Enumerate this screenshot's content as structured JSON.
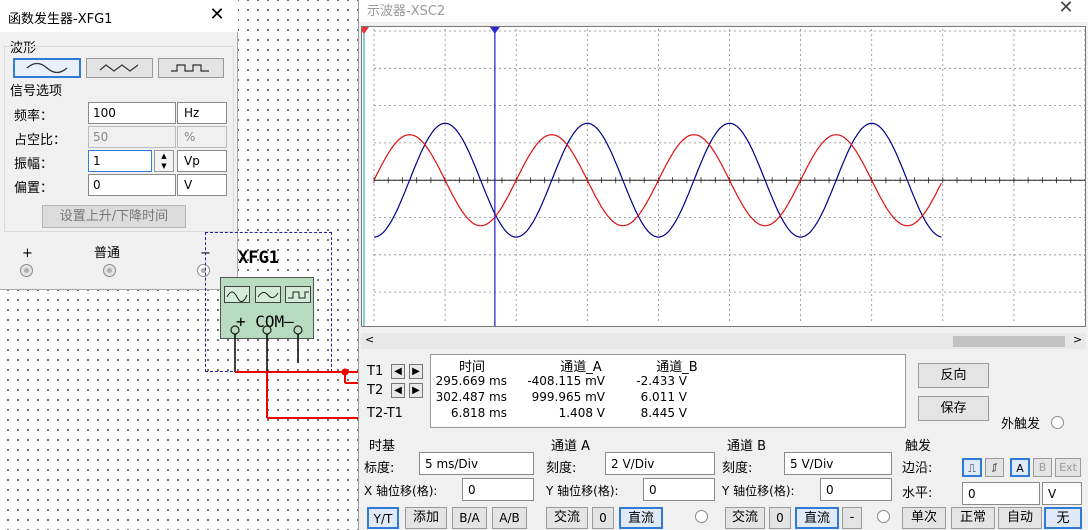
{
  "function_generator": {
    "title": "函数发生器-XFG1",
    "waveform_group": "波形",
    "waveforms": [
      "sine",
      "triangle",
      "square"
    ],
    "selected_waveform": "sine",
    "signal_options_group": "信号选项",
    "frequency": {
      "label": "频率：",
      "value": "100",
      "unit": "Hz"
    },
    "duty_cycle": {
      "label": "占空比：",
      "value": "50",
      "unit": "%"
    },
    "amplitude": {
      "label": "振幅：",
      "value": "1",
      "unit": "Vp"
    },
    "offset": {
      "label": "偏置：",
      "value": "0",
      "unit": "V"
    },
    "rise_fall_button": "设置上升/下降时间",
    "terminals": {
      "plus": "+",
      "common": "普通",
      "minus": "−"
    }
  },
  "schematic": {
    "instrument_label": "XFG1",
    "pins_text": "+ COM—"
  },
  "oscilloscope": {
    "title": "示波器-XSC2",
    "chart_data": {
      "type": "line",
      "x_unit": "ms",
      "time_per_div": "5 ms/Div",
      "x_range_ms": [
        0,
        50
      ],
      "y_divisions": [
        -4,
        4
      ],
      "grid": true,
      "series": [
        {
          "color": "#00008b",
          "channel": "A",
          "amplitude_v": 1,
          "frequency_hz": 100,
          "volts_per_div": 2,
          "phase_offset_ms": -2.5
        },
        {
          "color": "#dd1111",
          "channel": "B",
          "amplitude_v": 2,
          "frequency_hz": 100,
          "volts_per_div": 5,
          "phase_offset_ms": 0
        }
      ],
      "cursors": [
        {
          "name": "T1",
          "x_ms": 0,
          "color": "#33b0c8"
        },
        {
          "name": "T2",
          "x_ms": 8.5,
          "color": "#1a1ac0"
        }
      ]
    },
    "cursor_table": {
      "headers": [
        "时间",
        "通道_A",
        "通道_B"
      ],
      "rows": [
        {
          "label": "T1",
          "time": "295.669 ms",
          "a": "-408.115 mV",
          "b": "-2.433 V"
        },
        {
          "label": "T2",
          "time": "302.487 ms",
          "a": "999.965 mV",
          "b": "6.011 V"
        },
        {
          "label": "T2-T1",
          "time": "6.818 ms",
          "a": "1.408 V",
          "b": "8.445 V"
        }
      ]
    },
    "reverse_button": "反向",
    "save_button": "保存",
    "ext_trigger_label": "外触发",
    "timebase": {
      "title": "时基",
      "scale_label": "标度:",
      "scale_value": "5 ms/Div",
      "x_pos_label": "X 轴位移(格):",
      "x_pos_value": "0",
      "modes": [
        "Y/T",
        "添加",
        "B/A",
        "A/B"
      ]
    },
    "channel_a": {
      "title": "通道 A",
      "scale_label": "刻度:",
      "scale_value": "2  V/Div",
      "y_pos_label": "Y 轴位移(格):",
      "y_pos_value": "0",
      "coupling": [
        "交流",
        "0",
        "直流"
      ]
    },
    "channel_b": {
      "title": "通道 B",
      "scale_label": "刻度:",
      "scale_value": "5  V/Div",
      "y_pos_label": "Y 轴位移(格):",
      "y_pos_value": "0",
      "coupling": [
        "交流",
        "0",
        "直流",
        "-"
      ]
    },
    "trigger": {
      "title": "触发",
      "edge_label": "边沿:",
      "sources": [
        "A",
        "B",
        "Ext"
      ],
      "level_label": "水平:",
      "level_value": "0",
      "level_unit": "V",
      "modes": [
        "单次",
        "正常",
        "自动",
        "无"
      ]
    }
  },
  "colors": {
    "channel_a": "#00008b",
    "channel_b": "#dd1111",
    "accent": "#2f7bd6"
  }
}
